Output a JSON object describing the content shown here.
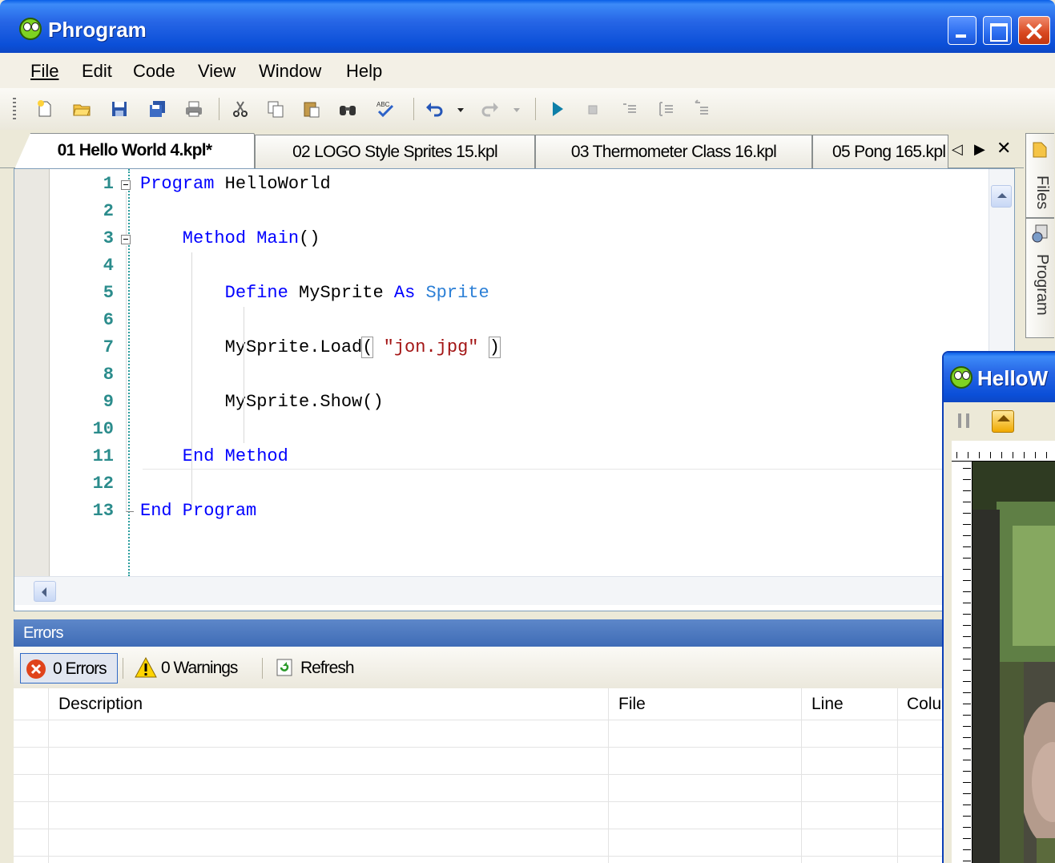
{
  "window": {
    "title": "Phrogram",
    "controls": {
      "minimize": "minimize",
      "maximize": "maximize",
      "close": "close"
    }
  },
  "menu": [
    {
      "label": "File",
      "accel_index": 0
    },
    {
      "label": "Edit",
      "accel_index": 0
    },
    {
      "label": "Code",
      "accel_index": 0
    },
    {
      "label": "View",
      "accel_index": 0
    },
    {
      "label": "Window",
      "accel_index": 0
    },
    {
      "label": "Help",
      "accel_index": 0
    }
  ],
  "toolbar": {
    "icons": [
      "new-file-icon",
      "open-folder-icon",
      "save-icon",
      "save-all-icon",
      "print-icon",
      "cut-icon",
      "copy-icon",
      "paste-icon",
      "find-icon",
      "spellcheck-icon",
      "undo-icon",
      "undo-dropdown-icon",
      "redo-icon",
      "redo-dropdown-icon",
      "run-icon",
      "stop-icon",
      "comment-icon",
      "uncomment-icon",
      "indent-icon"
    ]
  },
  "tabs": [
    {
      "label": "01 Hello World 4.kpl*",
      "active": true
    },
    {
      "label": "02 LOGO Style Sprites 15.kpl",
      "active": false
    },
    {
      "label": "03 Thermometer Class 16.kpl",
      "active": false
    },
    {
      "label": "05 Pong 165.kpl",
      "active": false
    }
  ],
  "editor": {
    "line_numbers": [
      "1",
      "2",
      "3",
      "4",
      "5",
      "6",
      "7",
      "8",
      "9",
      "10",
      "11",
      "12",
      "13"
    ],
    "lines": [
      {
        "tokens": [
          {
            "t": "Program",
            "c": "kw"
          },
          {
            "t": " HelloWorld",
            "c": "pl"
          }
        ]
      },
      {
        "tokens": []
      },
      {
        "tokens": [
          {
            "t": "    Method",
            "c": "kw"
          },
          {
            "t": " Main",
            "c": "kw"
          },
          {
            "t": "()",
            "c": "pl"
          }
        ]
      },
      {
        "tokens": []
      },
      {
        "tokens": [
          {
            "t": "        Define",
            "c": "kw"
          },
          {
            "t": " MySprite ",
            "c": "pl"
          },
          {
            "t": "As",
            "c": "kw"
          },
          {
            "t": " Sprite",
            "c": "ty"
          }
        ]
      },
      {
        "tokens": []
      },
      {
        "tokens": [
          {
            "t": "        MySprite.Load",
            "c": "pl"
          },
          {
            "t": "(",
            "c": "pl"
          },
          {
            "t": " \"jon.jpg\" ",
            "c": "st"
          },
          {
            "t": ")",
            "c": "pl"
          }
        ]
      },
      {
        "tokens": []
      },
      {
        "tokens": [
          {
            "t": "        MySprite.Show()",
            "c": "pl"
          }
        ]
      },
      {
        "tokens": []
      },
      {
        "tokens": [
          {
            "t": "    End",
            "c": "kw"
          },
          {
            "t": " Method",
            "c": "kw"
          }
        ]
      },
      {
        "tokens": []
      },
      {
        "tokens": [
          {
            "t": "End",
            "c": "kw"
          },
          {
            "t": " Program",
            "c": "kw"
          }
        ]
      }
    ]
  },
  "side_panel": {
    "tabs": [
      "Files",
      "Program"
    ]
  },
  "errors_panel": {
    "title": "Errors",
    "errors_button": "0 Errors",
    "warnings_button": "0 Warnings",
    "refresh_button": "Refresh",
    "columns": [
      "Description",
      "File",
      "Line",
      "Colu"
    ]
  },
  "run_window": {
    "title": "HelloW"
  },
  "colors": {
    "keyword": "#0000ff",
    "type": "#2b7fd6",
    "string": "#a31515",
    "line_number": "#2b8c8c",
    "title_bar": "#0b4fd8",
    "errors_header": "#4f79c0"
  }
}
